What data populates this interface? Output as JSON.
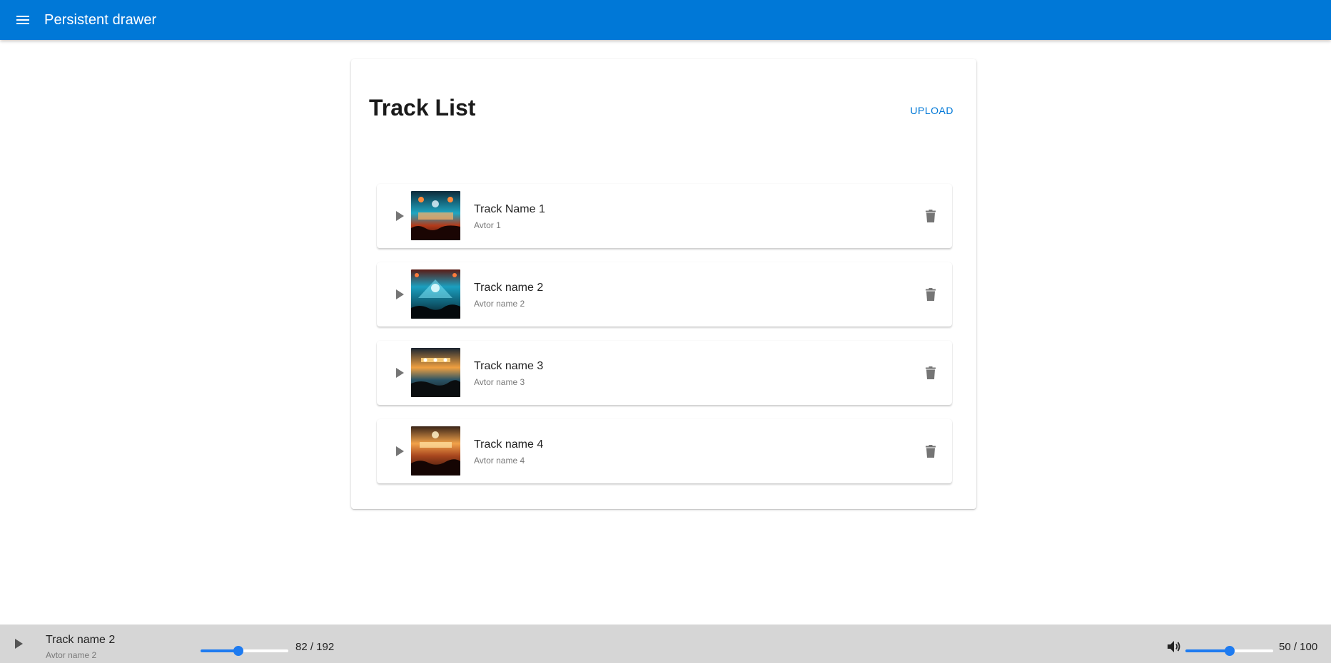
{
  "appbar": {
    "title": "Persistent drawer",
    "menu_icon": "menu-icon",
    "color": "#0078d7"
  },
  "card": {
    "title": "Track List",
    "upload_label": "UPLOAD"
  },
  "tracks": [
    {
      "name": "Track Name 1",
      "author": "Avtor 1",
      "cover": "concert-cover-image"
    },
    {
      "name": "Track name 2",
      "author": "Avtor name 2",
      "cover": "concert-cover-image"
    },
    {
      "name": "Track name 3",
      "author": "Avtor name 3",
      "cover": "concert-cover-image"
    },
    {
      "name": "Track name 4",
      "author": "Avtor name 4",
      "cover": "concert-cover-image"
    }
  ],
  "player": {
    "track_name": "Track name 2",
    "track_author": "Avtor name 2",
    "position": 82,
    "duration": 192,
    "progress_text": "82 / 192",
    "volume": 50,
    "volume_max": 100,
    "volume_text": "50 / 100",
    "accent": "#1e7bf0",
    "background": "#d6d6d6"
  }
}
